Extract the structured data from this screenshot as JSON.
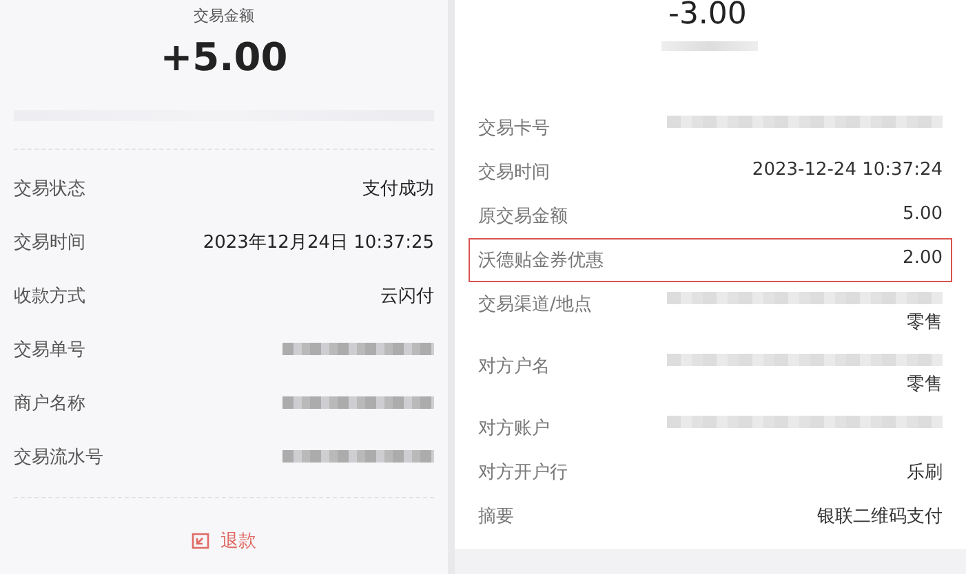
{
  "left": {
    "amount_label": "交易金额",
    "amount": "+5.00",
    "rows": [
      {
        "label": "交易状态",
        "kind": "text",
        "value": "支付成功"
      },
      {
        "label": "交易时间",
        "kind": "text",
        "value": "2023年12月24日 10:37:25"
      },
      {
        "label": "收款方式",
        "kind": "text",
        "value": "云闪付"
      },
      {
        "label": "交易单号",
        "kind": "redacted"
      },
      {
        "label": "商户名称",
        "kind": "redacted"
      },
      {
        "label": "交易流水号",
        "kind": "redacted"
      }
    ],
    "refund_button": "退款"
  },
  "right": {
    "amount": "-3.00",
    "rows": [
      {
        "label": "交易卡号",
        "kind": "redacted",
        "highlighted": false
      },
      {
        "label": "交易时间",
        "kind": "text",
        "value": "2023-12-24 10:37:24",
        "highlighted": false
      },
      {
        "label": "原交易金额",
        "kind": "text",
        "value": "5.00",
        "highlighted": false
      },
      {
        "label": "沃德贴金券优惠",
        "kind": "text",
        "value": "2.00",
        "highlighted": true
      },
      {
        "label": "交易渠道/地点",
        "kind": "redacted",
        "tail": "零售",
        "highlighted": false
      },
      {
        "label": "对方户名",
        "kind": "redacted",
        "tail": "零售",
        "highlighted": false
      },
      {
        "label": "对方账户",
        "kind": "redacted",
        "highlighted": false
      },
      {
        "label": "对方开户行",
        "kind": "text",
        "value": "乐刷",
        "highlighted": false
      },
      {
        "label": "摘要",
        "kind": "text",
        "value": "银联二维码支付",
        "highlighted": false
      }
    ]
  }
}
